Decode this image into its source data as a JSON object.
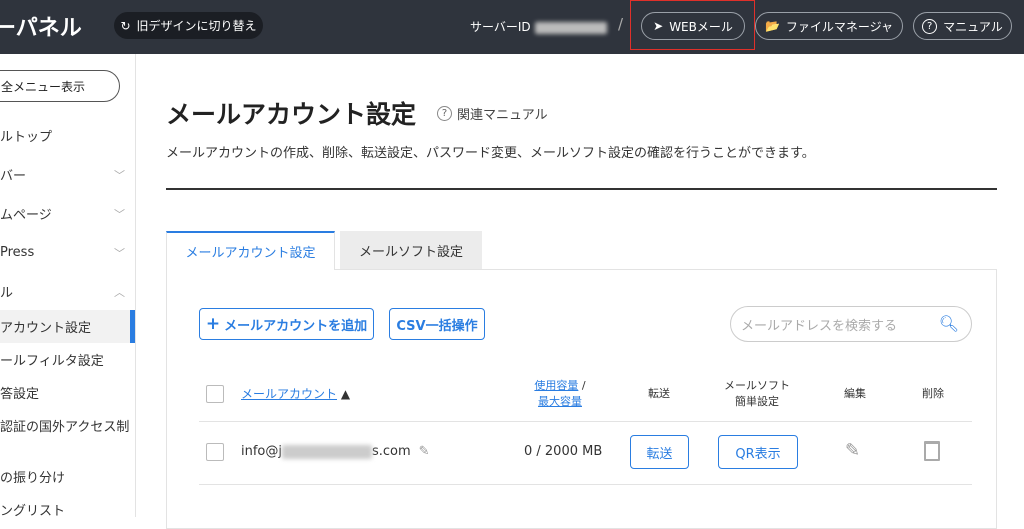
{
  "header": {
    "title": "ーパネル",
    "old_design": "旧デザインに切り替え",
    "server_id_label": "サーバーID",
    "separator": "/",
    "webmail": "WEBメール",
    "file_manager": "ファイルマネージャ",
    "manual": "マニュアル"
  },
  "sidebar": {
    "all_menu": "全メニュー表示",
    "items": [
      {
        "label": "ルトップ"
      },
      {
        "label": "バー",
        "chevron": "down"
      },
      {
        "label": "ムページ",
        "chevron": "down"
      },
      {
        "label": "Press",
        "chevron": "down"
      },
      {
        "label": "ル",
        "chevron": "up"
      },
      {
        "label": "アカウント設定",
        "active": true
      },
      {
        "label": "ールフィルタ設定"
      },
      {
        "label": "答設定"
      },
      {
        "label": "認証の国外アクセス制"
      },
      {
        "label": "の振り分け"
      },
      {
        "label": "ングリスト"
      }
    ]
  },
  "main": {
    "title": "メールアカウント設定",
    "related_manual": "関連マニュアル",
    "description": "メールアカウントの作成、削除、転送設定、パスワード変更、メールソフト設定の確認を行うことができます。",
    "tabs": [
      {
        "label": "メールアカウント設定",
        "active": true
      },
      {
        "label": "メールソフト設定"
      }
    ],
    "add_button": "メールアカウントを追加",
    "csv_button": "CSV一括操作",
    "search_placeholder": "メールアドレスを検索する",
    "table": {
      "headers": {
        "account": "メールアカウント",
        "sort": "▲",
        "usage": "使用容量",
        "usage_sep": " /",
        "max": "最大容量",
        "forward": "転送",
        "mailsoft1": "メールソフト",
        "mailsoft2": "簡単設定",
        "edit": "編集",
        "delete": "削除"
      },
      "rows": [
        {
          "email_prefix": "info@j",
          "email_suffix": "s.com",
          "usage": "0 / 2000 MB",
          "forward_button": "転送",
          "qr_button": "QR表示"
        }
      ]
    }
  },
  "colors": {
    "header_bg": "#2f343d",
    "accent": "#2a7de1",
    "highlight": "#e0302a"
  }
}
